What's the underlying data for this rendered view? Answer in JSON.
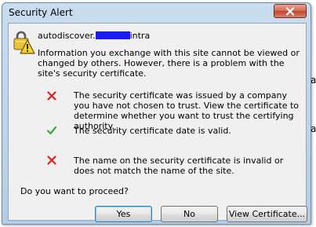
{
  "background": {
    "fragment": "a"
  },
  "dialog": {
    "title": "Security Alert",
    "host_prefix": "autodiscover.",
    "host_suffix": "intra",
    "intro": "Information you exchange with this site cannot be viewed or changed by others. However, there is a problem with the site's security certificate.",
    "items": [
      {
        "status": "error",
        "icon": "red-x-icon",
        "text": "The security certificate was issued by a company you have not chosen to trust. View the certificate to determine whether you want to trust the certifying authority."
      },
      {
        "status": "ok",
        "icon": "green-check-icon",
        "text": "The security certificate date is valid."
      },
      {
        "status": "error",
        "icon": "red-x-icon",
        "text": "The name on the security certificate is invalid or does not match the name of the site."
      }
    ],
    "question": "Do you want to proceed?",
    "buttons": {
      "yes": "Yes",
      "no": "No",
      "view": "View Certificate..."
    },
    "colors": {
      "error": "#e02020",
      "ok": "#3aa83a",
      "redaction": "#1b1bf5"
    }
  }
}
